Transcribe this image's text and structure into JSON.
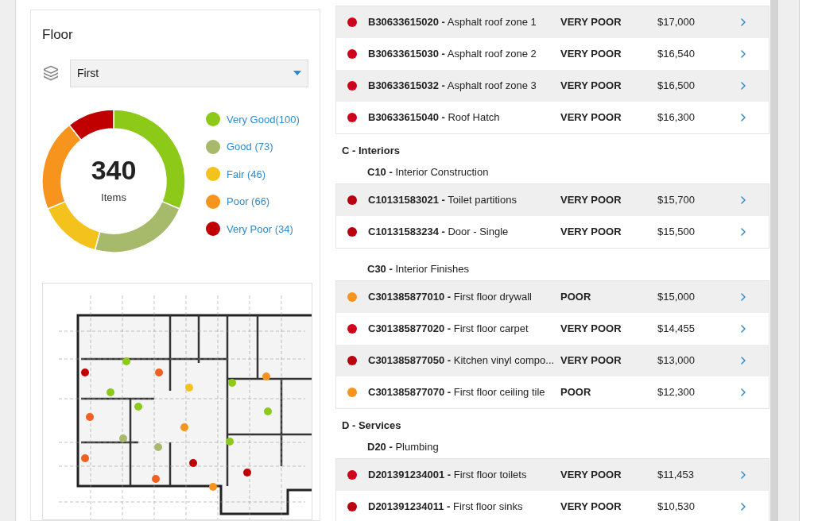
{
  "floor_panel": {
    "title": "Floor",
    "floor_select": {
      "value": "First"
    },
    "donut": {
      "total": "340",
      "total_label": "Items",
      "chart_data": {
        "type": "donut",
        "categories": [
          "Very Good(100)",
          "Good (73)",
          "Fair (46)",
          "Poor (66)",
          "Very Poor (34)"
        ],
        "values": [
          100,
          73,
          46,
          66,
          34
        ]
      }
    },
    "legend": [
      {
        "color": "#8cc919"
      },
      {
        "color": "#a7b96a"
      },
      {
        "color": "#f4c21d"
      },
      {
        "color": "#f7941d"
      },
      {
        "color": "#c00000"
      }
    ]
  },
  "sections": [
    {
      "groups": [
        {
          "rows": [
            {
              "label": "**B30633615020 -** Asphalt roof zone 1",
              "condition": "VERY POOR",
              "cost": "$17,000",
              "color": "#d0021b"
            },
            {
              "label": "**B30633615030 -** Asphalt roof zone 2",
              "condition": "VERY POOR",
              "cost": "$16,540",
              "color": "#d0021b"
            },
            {
              "label": "**B30633615032 -** Asphalt roof zone 3",
              "condition": "VERY POOR",
              "cost": "$16,500",
              "color": "#d0021b"
            },
            {
              "label": "**B30633615040 -** Roof Hatch",
              "condition": "VERY POOR",
              "cost": "$16,300",
              "color": "#d0021b"
            }
          ]
        }
      ]
    },
    {
      "title": "C - Interiors",
      "groups": [
        {
          "title": "**C10 -** Interior Construction",
          "rows": [
            {
              "label": "**C10131583021 -** Toilet partitions",
              "condition": "VERY POOR",
              "cost": "$15,700",
              "color": "#b8000f"
            },
            {
              "label": "**C10131583234 -** Door - Single",
              "condition": "VERY POOR",
              "cost": "$15,500",
              "color": "#b8000f"
            }
          ]
        },
        {
          "title": "**C30 -** Interior Finishes",
          "rows": [
            {
              "label": "**C301385877010 -** First floor drywall",
              "condition": "POOR",
              "cost": "$15,000",
              "color": "#f7941d"
            },
            {
              "label": "**C301385877020 -** First floor carpet",
              "condition": "VERY POOR",
              "cost": "$14,455",
              "color": "#d0021b"
            },
            {
              "label": "**C301385877050 -** Kitchen vinyl compo...",
              "condition": "VERY POOR",
              "cost": "$13,000",
              "color": "#b8000f"
            },
            {
              "label": "**C301385877070 -** First floor ceiling tile",
              "condition": "POOR",
              "cost": "$12,300",
              "color": "#f7941d"
            }
          ]
        }
      ]
    },
    {
      "title": "D - Services",
      "groups": [
        {
          "title": "**D20 -** Plumbing",
          "rows": [
            {
              "label": "**D201391234001 -** First floor toilets",
              "condition": "VERY POOR",
              "cost": "$11,453",
              "color": "#d0021b"
            },
            {
              "label": "**D201391234011 -** First floor sinks",
              "condition": "VERY POOR",
              "cost": "$10,530",
              "color": "#b8000f"
            }
          ]
        }
      ]
    }
  ]
}
